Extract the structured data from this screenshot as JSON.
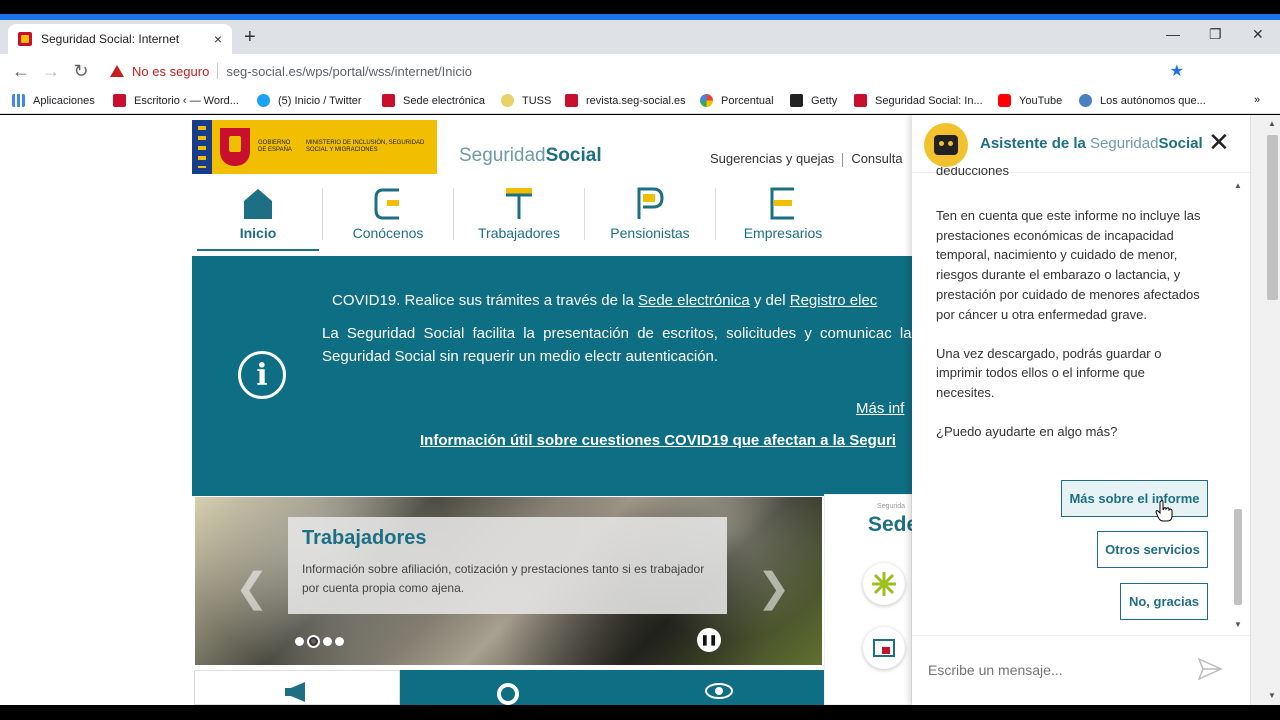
{
  "browser": {
    "tab_title": "Seguridad Social: Internet",
    "tab_close": "×",
    "new_tab": "+",
    "security_label": "No es seguro",
    "url": "seg-social.es/wps/portal/wss/internet/Inicio",
    "bookmarks": [
      {
        "label": "Aplicaciones",
        "icon": "apps-grid-icon"
      },
      {
        "label": "Escritorio ‹ — Word...",
        "icon": "spain-flag-icon"
      },
      {
        "label": "(5) Inicio / Twitter",
        "icon": "twitter-icon"
      },
      {
        "label": "Sede electrónica",
        "icon": "spain-flag-icon"
      },
      {
        "label": "TUSS",
        "icon": "tuss-icon"
      },
      {
        "label": "revista.seg-social.es",
        "icon": "spain-flag-icon"
      },
      {
        "label": "Porcentual",
        "icon": "porcentual-icon"
      },
      {
        "label": "Getty",
        "icon": "getty-icon"
      },
      {
        "label": "Seguridad Social: In...",
        "icon": "spain-flag-icon"
      },
      {
        "label": "YouTube",
        "icon": "youtube-icon"
      },
      {
        "label": "Los autónomos que...",
        "icon": "globe-icon"
      }
    ],
    "bookmarks_more": "»"
  },
  "header": {
    "gov_label": "GOBIERNO DE ESPAÑA",
    "ministry_label": "MINISTERIO DE INCLUSIÓN, SEGURIDAD SOCIAL Y MIGRACIONES",
    "logo_light": "Seguridad",
    "logo_bold": "Social",
    "links": [
      "Sugerencias y quejas",
      "Consulta"
    ]
  },
  "nav": [
    {
      "label": "Inicio",
      "icon": "home-icon",
      "active": true
    },
    {
      "label": "Conócenos",
      "icon": "c-letter-icon"
    },
    {
      "label": "Trabajadores",
      "icon": "t-letter-icon"
    },
    {
      "label": "Pensionistas",
      "icon": "p-letter-icon"
    },
    {
      "label": "Empresarios",
      "icon": "e-letter-icon"
    }
  ],
  "banner": {
    "line1_prefix": "COVID19. Realice sus trámites a través de la ",
    "line1_link1": "Sede electrónica",
    "line1_mid": " y del ",
    "line1_link2": "Registro elec",
    "paragraph": "La Seguridad Social facilita la presentación de escritos, solicitudes y comunicac la Sede Electrónica de la Seguridad Social sin requerir un medio electr autenticación.",
    "more_link": "Más inf",
    "useful_link": "Información útil sobre cuestiones COVID19 que afectan a la Seguri"
  },
  "carousel": {
    "title": "Trabajadores",
    "description": "Información sobre afiliación, cotización y prestaciones tanto si es trabajador por cuenta propia como ajena.",
    "prev": "❮",
    "next": "❯",
    "pause": "❚❚"
  },
  "sede": {
    "small": "Segurida",
    "big": "Sede"
  },
  "chat": {
    "title_prefix": "Asistente de la",
    "title_light": "Seguridad",
    "title_bold": "Social",
    "close": "✕",
    "cut_line": "deducciones",
    "messages": [
      "Ten en cuenta que este informe no incluye las prestaciones económicas de incapacidad temporal, nacimiento y cuidado de menor, riesgos durante el embarazo o lactancia, y prestación por cuidado de menores afectados por cáncer u otra enfermedad grave.",
      "Una vez descargado, podrás guardar o imprimir todos ellos o el informe que necesites.",
      "¿Puedo ayudarte en algo más?"
    ],
    "quick_replies": [
      "Más sobre el informe",
      "Otros servicios",
      "No, gracias"
    ],
    "input_placeholder": "Escribe un mensaje..."
  }
}
